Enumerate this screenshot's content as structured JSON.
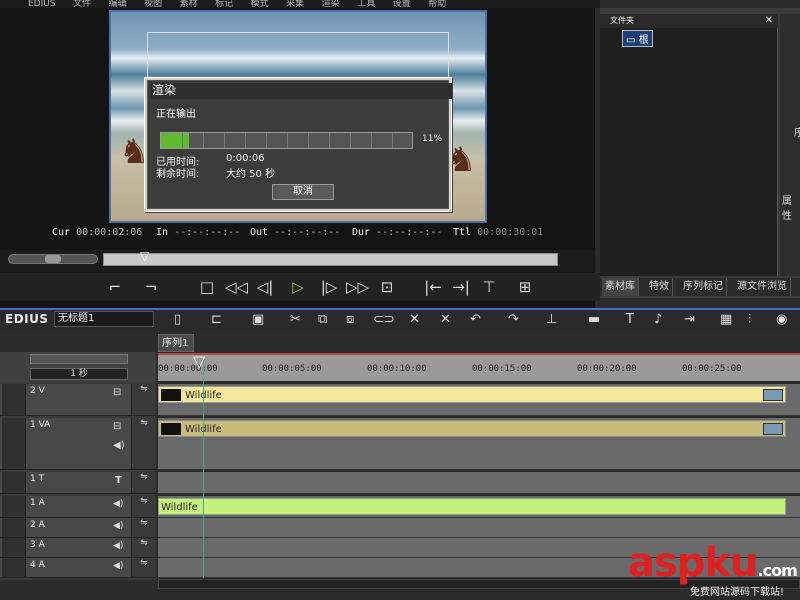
{
  "menu": [
    "EDIUS",
    "文件",
    "编辑",
    "视图",
    "素材",
    "标记",
    "模式",
    "采集",
    "渲染",
    "工具",
    "设置",
    "帮助"
  ],
  "player": {
    "timecode": {
      "cur_label": "Cur",
      "cur_value": "00:00:02:06",
      "in_label": "In",
      "in_value": "--:--:--:--",
      "out_label": "Out",
      "out_value": "--:--:--:--",
      "dur_label": "Dur",
      "dur_value": "--:--:--:--",
      "ttl_label": "Ttl",
      "ttl_value": "00:00:30:01"
    }
  },
  "render_dialog": {
    "title": "渲染",
    "message": "正在输出",
    "progress_percent": 11,
    "progress_text": "11%",
    "elapsed_label": "已用时间:",
    "elapsed_value": "0:00:06",
    "remaining_label": "剩余时间:",
    "remaining_value": "大约 50 秒",
    "cancel_label": "取消"
  },
  "bin": {
    "header": "文件夹",
    "root_label": "根",
    "side_labels": [
      "序",
      "属性"
    ],
    "tabs": [
      "素材库",
      "特效",
      "序列标记",
      "源文件浏览"
    ]
  },
  "timeline": {
    "app_name": "EDIUS",
    "project_name": "无标题1",
    "sequence_tab": "序列1",
    "zoom_label": "1 秒",
    "ruler_labels": [
      "00:00:00:00",
      "00:00:05:00",
      "00:00:10:00",
      "00:00:15:00",
      "00:00:20:00",
      "00:00:25:00"
    ],
    "tracks": [
      {
        "name": "2 V",
        "clip": "Wildlife"
      },
      {
        "name": "1 VA",
        "clip": "Wildlife"
      },
      {
        "name": "1 T",
        "clip": ""
      },
      {
        "name": "1 A",
        "clip": "Wildlife"
      },
      {
        "name": "2 A",
        "clip": ""
      },
      {
        "name": "3 A",
        "clip": ""
      },
      {
        "name": "4 A",
        "clip": ""
      }
    ]
  },
  "watermark": {
    "brand": "aspku",
    "suffix": ".com",
    "tagline": "免费网站源码下载站!"
  },
  "colors": {
    "progress": "#5fba2f",
    "video_clip": "#f6e89a",
    "audio_clip": "#c5f07c",
    "accent_border": "#3c6dd0"
  }
}
